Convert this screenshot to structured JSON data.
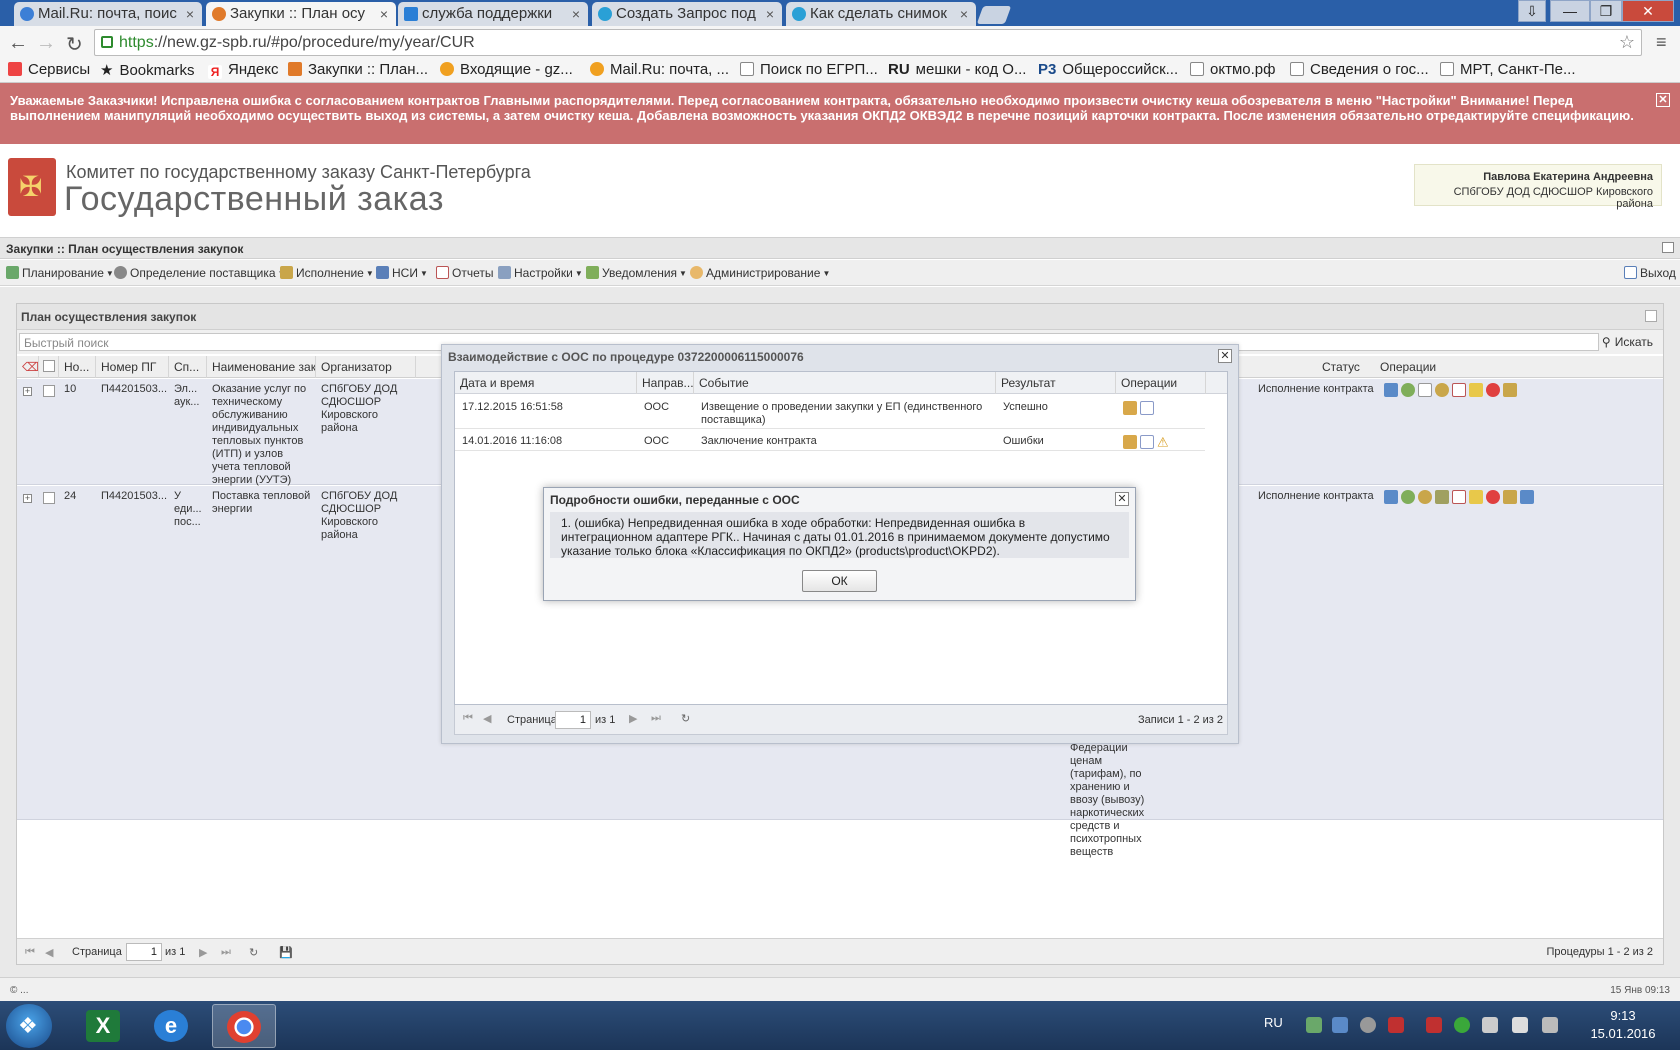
{
  "browser": {
    "tabs": [
      {
        "label": "Mail.Ru: почта, поис"
      },
      {
        "label": "Закупки :: План осу"
      },
      {
        "label": "служба поддержки"
      },
      {
        "label": "Создать Запрос под"
      },
      {
        "label": "Как сделать снимок"
      }
    ],
    "url_scheme": "https",
    "url_rest": "://new.gz-spb.ru/#po/procedure/my/year/CUR",
    "bookmarks": [
      {
        "label": "Сервисы"
      },
      {
        "label": "Bookmarks"
      },
      {
        "label": "Яндекс"
      },
      {
        "label": "Закупки :: План..."
      },
      {
        "label": "Входящие - gz..."
      },
      {
        "label": "Mail.Ru: почта, ..."
      },
      {
        "label": "Поиск по ЕГРП..."
      },
      {
        "label": "мешки - код О..."
      },
      {
        "label": "Общероссийск..."
      },
      {
        "label": "октмо.рф"
      },
      {
        "label": "Сведения о гос..."
      },
      {
        "label": "МРТ, Санкт-Пе..."
      }
    ],
    "bookmark_prefix_ru": "RU",
    "bookmark_prefix_p3": "P3"
  },
  "alert": {
    "text": "Уважаемые Заказчики! Исправлена ошибка с согласованием контрактов Главными распорядителями. Перед согласованием контракта, обязательно необходимо произвести очистку кеша обозревателя в меню \"Настройки\" Внимание! Перед выполнением манипуляций необходимо осуществить выход из системы, а затем очистку кеша. Добавлена возможность указания ОКПД2 ОКВЭД2 в перечне позиций карточки контракта. После изменения обязательно отредактируйте спецификацию."
  },
  "header": {
    "org_line1": "Комитет по государственному заказу Санкт-Петербурга",
    "org_line2": "Государственный заказ",
    "user_name": "Павлова Екатерина Андреевна",
    "user_org": "СПбГОБУ ДОД СДЮСШОР Кировского района"
  },
  "app": {
    "breadcrumb": "Закупки :: План осуществления закупок",
    "menu": [
      {
        "label": "Планирование",
        "caret": true
      },
      {
        "label": "Определение поставщика",
        "caret": true
      },
      {
        "label": "Исполнение",
        "caret": true
      },
      {
        "label": "НСИ",
        "caret": true
      },
      {
        "label": "Отчеты",
        "caret": false
      },
      {
        "label": "Настройки",
        "caret": true
      },
      {
        "label": "Уведомления",
        "caret": true
      },
      {
        "label": "Администрирование",
        "caret": true
      }
    ],
    "exit_label": "Выход"
  },
  "grid": {
    "title": "План осуществления закупок",
    "search_placeholder": "Быстрый поиск",
    "search_button": "Искать",
    "columns": [
      "Но...",
      "Номер ПГ",
      "Сп...",
      "Наименование зак...",
      "Организатор",
      "Статус",
      "Операции"
    ],
    "rows": [
      {
        "no": "10",
        "plan_number": "П44201503...",
        "method": "Эл... аук...",
        "name": "Оказание услуг по техническому обслуживанию индивидуальных тепловых пунктов (ИТП) и узлов учета тепловой энергии (УУТЭ)",
        "organizer": "СПбГОБУ ДОД СДЮСШОР Кировского района",
        "status": "Исполнение контракта"
      },
      {
        "no": "24",
        "plan_number": "П44201503...",
        "method": "У еди... пос...",
        "name": "Поставка тепловой энергии",
        "organizer": "СПбГОБУ ДОД СДЮСШОР Кировского района",
        "status": "Исполнение контракта"
      }
    ],
    "overflow_text": "Федерации ценам (тарифам), по хранению и ввозу (вывозу) наркотических средств и психотропных веществ",
    "page_label": "Страница",
    "page_value": "1",
    "page_of": "из 1",
    "summary": "Процедуры 1 - 2 из 2"
  },
  "modal_interaction": {
    "title": "Взаимодействие с ООС по процедуре 0372200006115000076",
    "columns": [
      "Дата и время",
      "Направ...",
      "Событие",
      "Результат",
      "Операции"
    ],
    "rows": [
      {
        "datetime": "17.12.2015 16:51:58",
        "direction": "ООС",
        "event": "Извещение о проведении закупки у ЕП (единственного поставщика)",
        "result": "Успешно"
      },
      {
        "datetime": "14.01.2016 11:16:08",
        "direction": "ООС",
        "event": "Заключение контракта",
        "result": "Ошибки"
      }
    ],
    "page_label": "Страница",
    "page_value": "1",
    "page_of": "из 1",
    "summary": "Записи 1 - 2 из 2"
  },
  "modal_error": {
    "title": "Подробности ошибки, переданные с ООС",
    "message": "1. (ошибка) Непредвиденная ошибка в ходе обработки: Непредвиденная ошибка в интеграционном адаптере РГК.. Начиная с даты 01.01.2016 в принимаемом документе допустимо указание только блока «Классификация по ОКПД2» (products\\product\\OKPD2).",
    "ok_label": "ОК"
  },
  "status_bar": {
    "left": "© ...",
    "right": "15 Янв 09:13"
  },
  "taskbar": {
    "lang": "RU",
    "time": "9:13",
    "date": "15.01.2016"
  },
  "colors": {
    "alert_bg": "#c96f6f",
    "tabstrip": "#2a5fa8",
    "row_bg": "#e6e8f1"
  }
}
